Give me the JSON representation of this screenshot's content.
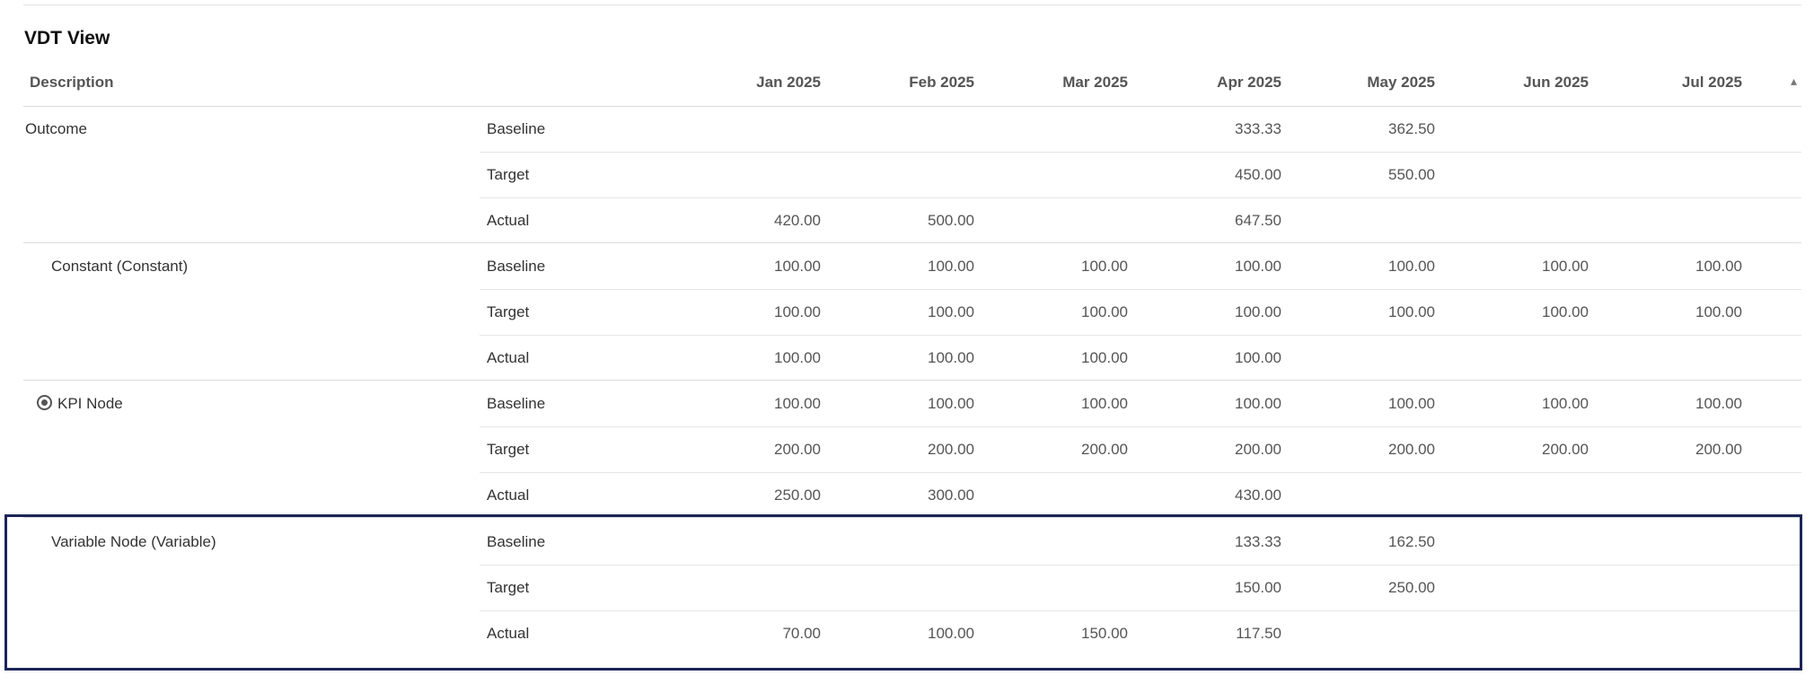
{
  "view": {
    "title": "VDT View"
  },
  "table": {
    "description_header": "Description",
    "months": [
      "Jan 2025",
      "Feb 2025",
      "Mar 2025",
      "Apr 2025",
      "May 2025",
      "Jun 2025",
      "Jul 2025"
    ],
    "groups": [
      {
        "label": "Outcome",
        "rows": [
          {
            "metric": "Baseline",
            "values": [
              "",
              "",
              "",
              "333.33",
              "362.50",
              "",
              ""
            ]
          },
          {
            "metric": "Target",
            "values": [
              "",
              "",
              "",
              "450.00",
              "550.00",
              "",
              ""
            ]
          },
          {
            "metric": "Actual",
            "values": [
              "420.00",
              "500.00",
              "",
              "647.50",
              "",
              "",
              ""
            ]
          }
        ]
      },
      {
        "label": "Constant (Constant)",
        "rows": [
          {
            "metric": "Baseline",
            "values": [
              "100.00",
              "100.00",
              "100.00",
              "100.00",
              "100.00",
              "100.00",
              "100.00"
            ]
          },
          {
            "metric": "Target",
            "values": [
              "100.00",
              "100.00",
              "100.00",
              "100.00",
              "100.00",
              "100.00",
              "100.00"
            ]
          },
          {
            "metric": "Actual",
            "values": [
              "100.00",
              "100.00",
              "100.00",
              "100.00",
              "",
              "",
              ""
            ]
          }
        ]
      },
      {
        "label": "KPI Node",
        "icon": "target-icon",
        "rows": [
          {
            "metric": "Baseline",
            "values": [
              "100.00",
              "100.00",
              "100.00",
              "100.00",
              "100.00",
              "100.00",
              "100.00"
            ]
          },
          {
            "metric": "Target",
            "values": [
              "200.00",
              "200.00",
              "200.00",
              "200.00",
              "200.00",
              "200.00",
              "200.00"
            ]
          },
          {
            "metric": "Actual",
            "values": [
              "250.00",
              "300.00",
              "",
              "430.00",
              "",
              "",
              ""
            ]
          }
        ]
      },
      {
        "label": "Variable Node (Variable)",
        "highlighted": true,
        "rows": [
          {
            "metric": "Baseline",
            "values": [
              "",
              "",
              "",
              "133.33",
              "162.50",
              "",
              ""
            ]
          },
          {
            "metric": "Target",
            "values": [
              "",
              "",
              "",
              "150.00",
              "250.00",
              "",
              ""
            ]
          },
          {
            "metric": "Actual",
            "values": [
              "70.00",
              "100.00",
              "150.00",
              "117.50",
              "",
              "",
              ""
            ]
          }
        ]
      }
    ]
  },
  "colors": {
    "highlight_border": "#1b2557",
    "divider": "#dcdcdc"
  }
}
